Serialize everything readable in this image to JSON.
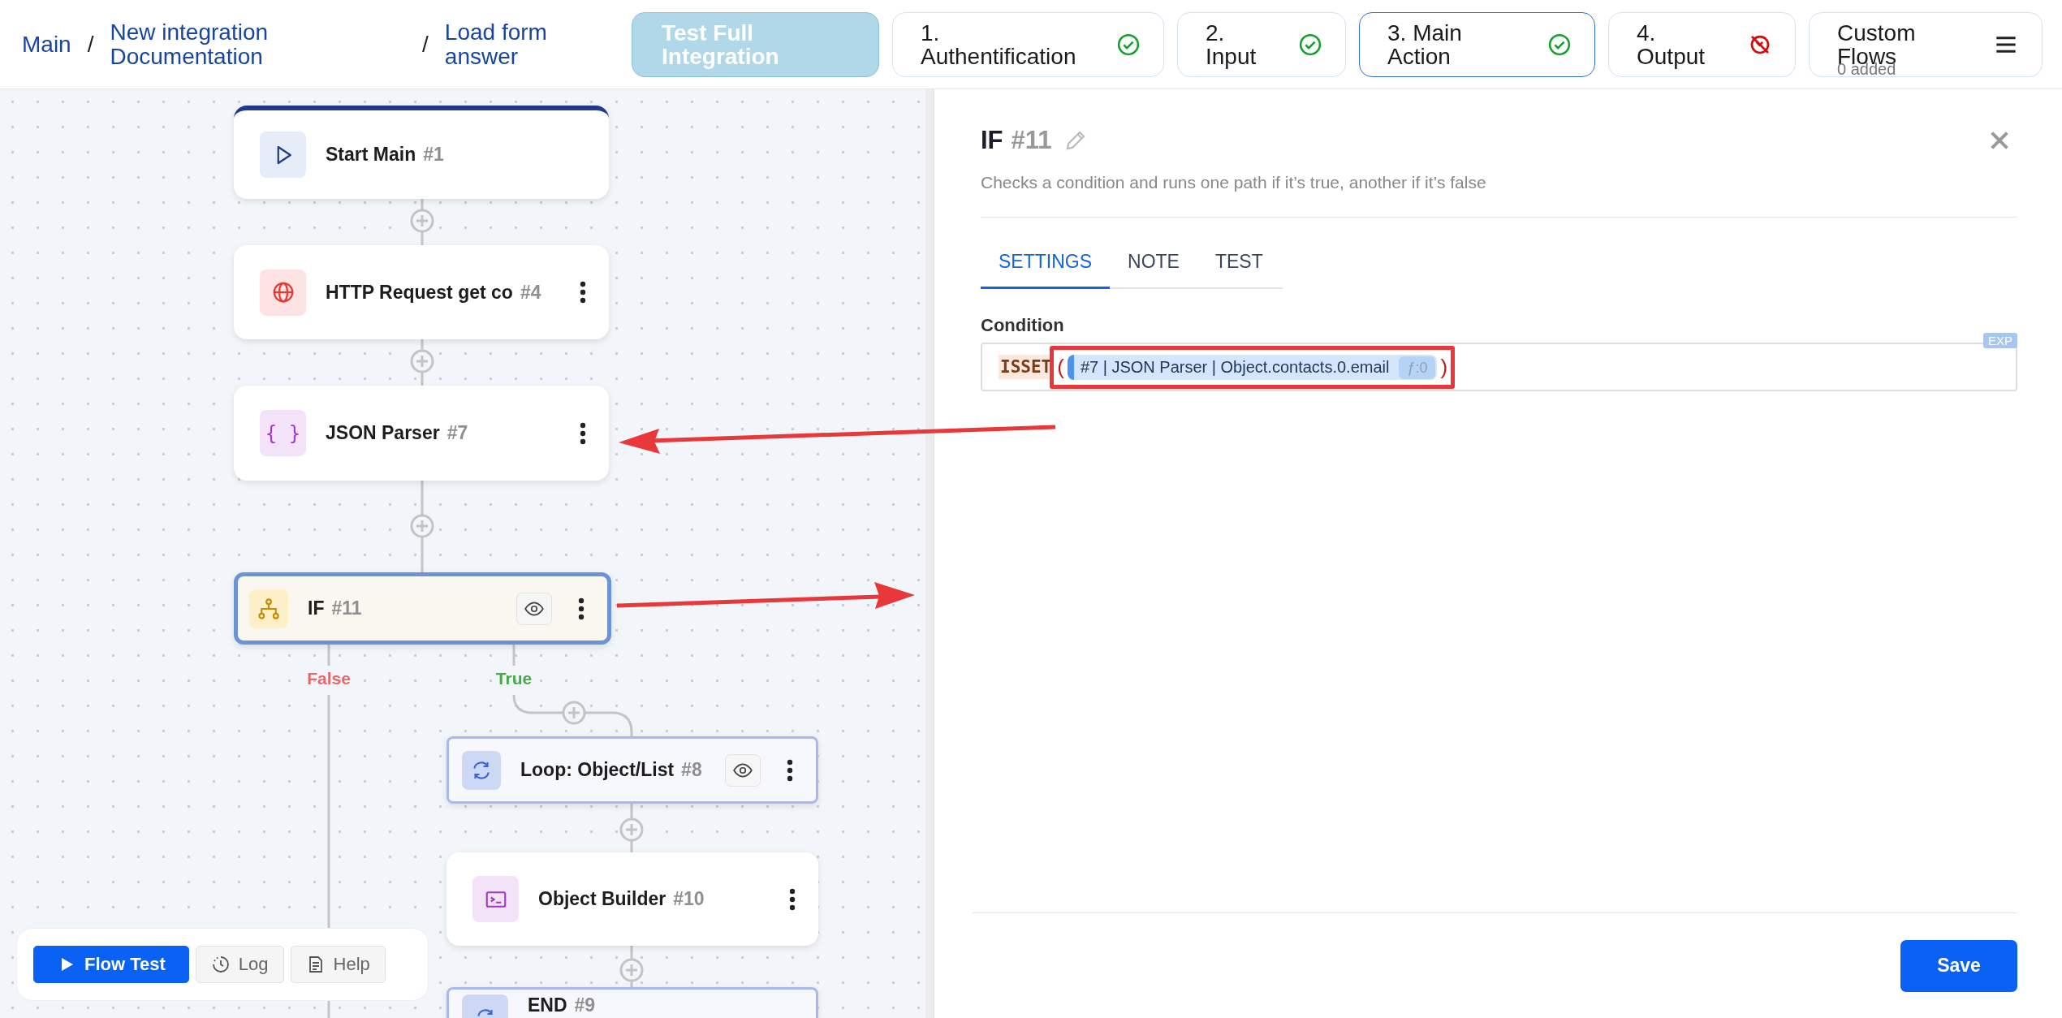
{
  "breadcrumbs": [
    {
      "kind": "link",
      "label": "Main"
    },
    {
      "kind": "separator",
      "label": "/"
    },
    {
      "kind": "link",
      "label": "New integration\nDocumentation"
    },
    {
      "kind": "separator",
      "label": "/"
    },
    {
      "kind": "link",
      "label": "Load form\nanswer"
    }
  ],
  "test_button": {
    "label": "Test Full\nIntegration",
    "disabled": true
  },
  "steps": [
    {
      "label": "1.\nAuthentification",
      "kind": "done",
      "selected": false
    },
    {
      "label": "2.\nInput",
      "kind": "done",
      "selected": false
    },
    {
      "label": "3. Main\nAction",
      "kind": "done",
      "selected": true
    },
    {
      "label": "4.\nOutput",
      "kind": "error",
      "selected": false
    }
  ],
  "custom_flows": {
    "label": "Custom\nFlows",
    "count": "0 added"
  },
  "flow": {
    "nodes": [
      {
        "kind": "start",
        "title": "Start Main",
        "number": "#1",
        "selected": false,
        "preview": false,
        "menu": false
      },
      {
        "kind": "http",
        "title": "HTTP Request get co",
        "number": "#4",
        "selected": false,
        "preview": false,
        "menu": true
      },
      {
        "kind": "json",
        "icon_text": "{ }",
        "title": "JSON Parser",
        "number": "#7",
        "selected": false,
        "preview": false,
        "menu": true
      },
      {
        "kind": "if",
        "title": "IF",
        "number": "#11",
        "selected": true,
        "preview": true,
        "menu": true
      },
      {
        "kind": "loop",
        "title": "Loop: Object/List",
        "number": "#8",
        "selected": false,
        "preview": true,
        "menu": true
      },
      {
        "kind": "object",
        "title": "Object Builder",
        "number": "#10",
        "selected": false,
        "preview": false,
        "menu": true
      },
      {
        "kind": "end",
        "title": "END",
        "number": "#9",
        "selected": false,
        "preview": false,
        "menu": false
      }
    ],
    "branches": [
      {
        "kind": "false",
        "label": "False"
      },
      {
        "kind": "true",
        "label": "True"
      }
    ]
  },
  "toolbar": [
    {
      "kind": "play",
      "label": "Flow Test",
      "primary": true
    },
    {
      "kind": "log",
      "label": "Log",
      "primary": false
    },
    {
      "kind": "help",
      "label": "Help",
      "primary": false
    }
  ],
  "panel": {
    "title": "IF",
    "number": "#11",
    "description": "Checks a condition and runs one path if it’s true, another if it’s false",
    "tabs": [
      {
        "label": "SETTINGS",
        "selected": true
      },
      {
        "label": "NOTE",
        "selected": false
      },
      {
        "label": "TEST",
        "selected": false
      }
    ],
    "condition": {
      "label": "Condition",
      "badge": "EXP",
      "function": "ISSET",
      "open": "(",
      "token": "#7 | JSON Parser | Object.contacts.0.email",
      "token_tag": "ƒ:0",
      "close": ")"
    },
    "save": "Save"
  }
}
